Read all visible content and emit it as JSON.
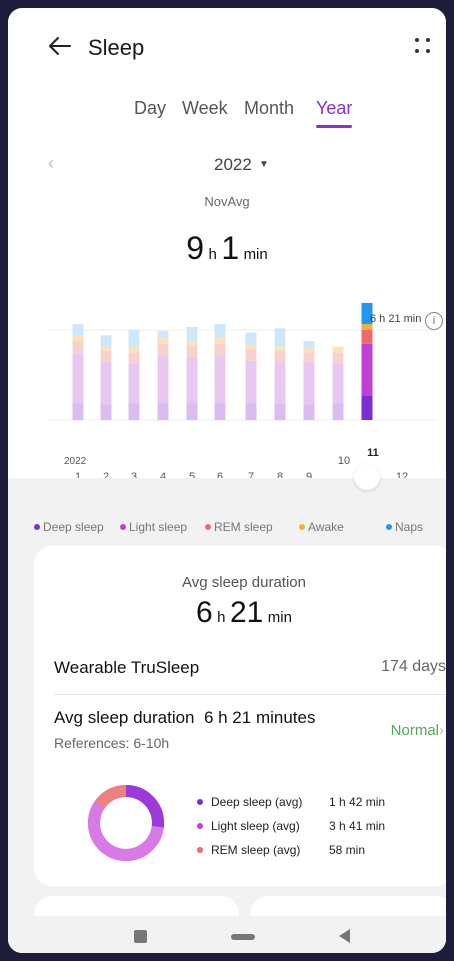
{
  "header": {
    "title": "Sleep",
    "back_icon": "arrow-left-icon",
    "more_icon": "more-dots-icon"
  },
  "tabs": [
    {
      "label": "Day",
      "active": false
    },
    {
      "label": "Week",
      "active": false
    },
    {
      "label": "Month",
      "active": false
    },
    {
      "label": "Year",
      "active": true
    }
  ],
  "period": {
    "year": "2022",
    "sub_label": "NovAvg",
    "avg_hours": "9",
    "avg_h_unit": "h",
    "avg_minutes": "1",
    "avg_min_unit": "min"
  },
  "chart_data": {
    "type": "bar",
    "stacked": true,
    "x_year_label": "2022",
    "categories": [
      "1",
      "2",
      "3",
      "4",
      "5",
      "6",
      "7",
      "8",
      "9",
      "10",
      "11",
      "12"
    ],
    "selected_index": 10,
    "reference_label": "6 h 21 min",
    "series": [
      {
        "name": "Deep sleep",
        "color": "#7b2fd0",
        "values": [
          1.2,
          1.1,
          1.2,
          1.2,
          1.2,
          1.2,
          1.2,
          1.1,
          1.1,
          1.2,
          1.7,
          0
        ]
      },
      {
        "name": "Light sleep",
        "color": "#c23fd6",
        "values": [
          3.5,
          3.0,
          2.8,
          3.3,
          3.2,
          3.3,
          3.0,
          3.0,
          3.0,
          2.8,
          3.7,
          0
        ]
      },
      {
        "name": "REM sleep",
        "color": "#ef6b6b",
        "values": [
          0.9,
          0.8,
          0.8,
          0.9,
          0.9,
          0.9,
          0.8,
          0.8,
          0.7,
          0.8,
          1.0,
          0
        ]
      },
      {
        "name": "Awake",
        "color": "#f2b233",
        "values": [
          0.4,
          0.3,
          0.4,
          0.4,
          0.3,
          0.4,
          0.3,
          0.3,
          0.3,
          0.4,
          0.4,
          0
        ]
      },
      {
        "name": "Naps",
        "color": "#2196f3",
        "values": [
          0.8,
          0.8,
          1.2,
          0.5,
          1.0,
          1.0,
          0.9,
          1.3,
          0.5,
          0,
          1.5,
          0
        ]
      }
    ],
    "ylim": [
      0,
      9.5
    ]
  },
  "legend": [
    {
      "label": "Deep sleep",
      "color": "#7b2fd0"
    },
    {
      "label": "Light sleep",
      "color": "#c23fd6"
    },
    {
      "label": "REM sleep",
      "color": "#ef6b6b"
    },
    {
      "label": "Awake",
      "color": "#f2b233"
    },
    {
      "label": "Naps",
      "color": "#2196f3"
    }
  ],
  "card": {
    "title": "Avg sleep duration",
    "hours": "6",
    "h_unit": "h",
    "minutes": "21",
    "min_unit": "min",
    "source_label": "Wearable TruSleep",
    "source_days": "174 days",
    "avg_line": "Avg sleep duration  6 h 21 minutes",
    "references": "References: 6-10h",
    "status": "Normal",
    "stats": [
      {
        "name": "Deep sleep (avg)",
        "value": "1 h 42 min",
        "color": "#7b2fd0"
      },
      {
        "name": "Light sleep (avg)",
        "value": "3 h 41 min",
        "color": "#c23fd6"
      },
      {
        "name": "REM sleep (avg)",
        "value": "58 min",
        "color": "#ef6b6b"
      }
    ],
    "donut_share": {
      "deep": 0.27,
      "light": 0.58,
      "rem": 0.15
    }
  }
}
